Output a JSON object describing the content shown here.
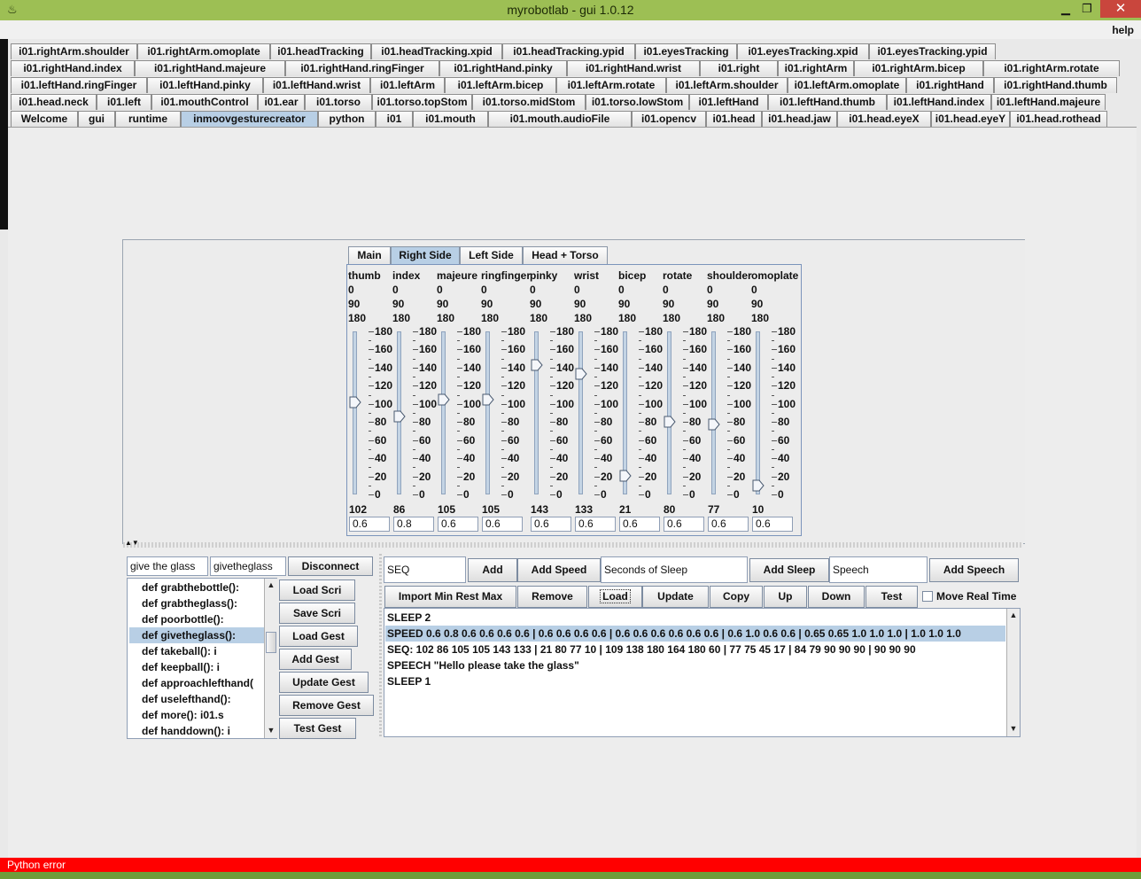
{
  "window": {
    "title": "myrobotlab - gui 1.0.12",
    "close_glyph": "✕",
    "min_glyph": "▁",
    "max_glyph": "❐"
  },
  "menu": {
    "help": "help"
  },
  "tabs": {
    "row1": [
      "i01.rightArm.shoulder",
      "i01.rightArm.omoplate",
      "i01.headTracking",
      "i01.headTracking.xpid",
      "i01.headTracking.ypid",
      "i01.eyesTracking",
      "i01.eyesTracking.xpid",
      "i01.eyesTracking.ypid"
    ],
    "row2": [
      "i01.rightHand.index",
      "i01.rightHand.majeure",
      "i01.rightHand.ringFinger",
      "i01.rightHand.pinky",
      "i01.rightHand.wrist",
      "i01.right",
      "i01.rightArm",
      "i01.rightArm.bicep",
      "i01.rightArm.rotate"
    ],
    "row3": [
      "i01.leftHand.ringFinger",
      "i01.leftHand.pinky",
      "i01.leftHand.wrist",
      "i01.leftArm",
      "i01.leftArm.bicep",
      "i01.leftArm.rotate",
      "i01.leftArm.shoulder",
      "i01.leftArm.omoplate",
      "i01.rightHand",
      "i01.rightHand.thumb"
    ],
    "row4": [
      "i01.head.neck",
      "i01.left",
      "i01.mouthControl",
      "i01.ear",
      "i01.torso",
      "i01.torso.topStom",
      "i01.torso.midStom",
      "i01.torso.lowStom",
      "i01.leftHand",
      "i01.leftHand.thumb",
      "i01.leftHand.index",
      "i01.leftHand.majeure"
    ],
    "row5": [
      "Welcome",
      "gui",
      "runtime",
      "inmoovgesturecreator",
      "python",
      "i01",
      "i01.mouth",
      "i01.mouth.audioFile",
      "i01.opencv",
      "i01.head",
      "i01.head.jaw",
      "i01.head.eyeX",
      "i01.head.eyeY",
      "i01.head.rothead"
    ],
    "selected_row5": "inmoovgesturecreator"
  },
  "inner_tabs": {
    "items": [
      "Main",
      "Right Side",
      "Left Side",
      "Head + Torso"
    ],
    "selected": "Right Side"
  },
  "sliders": {
    "min_label": "0",
    "mid_label": "90",
    "max_label": "180",
    "tick_labels": [
      "180",
      "160",
      "140",
      "120",
      "100",
      "80",
      "60",
      "40",
      "20",
      "0"
    ],
    "columns": [
      {
        "name": "thumb",
        "value": 102,
        "speed": "0.6"
      },
      {
        "name": "index",
        "value": 86,
        "speed": "0.8"
      },
      {
        "name": "majeure",
        "value": 105,
        "speed": "0.6"
      },
      {
        "name": "ringfinger",
        "value": 105,
        "speed": "0.6"
      },
      {
        "name": "pinky",
        "value": 143,
        "speed": "0.6"
      },
      {
        "name": "wrist",
        "value": 133,
        "speed": "0.6"
      },
      {
        "name": "bicep",
        "value": 21,
        "speed": "0.6"
      },
      {
        "name": "rotate",
        "value": 80,
        "speed": "0.6"
      },
      {
        "name": "shoulder",
        "value": 77,
        "speed": "0.6"
      },
      {
        "name": "omoplate",
        "value": 10,
        "speed": "0.6"
      }
    ]
  },
  "gesture": {
    "name_field": "give the glass",
    "func_field": "givetheglass",
    "disconnect": "Disconnect",
    "list": [
      "def grabthebottle():",
      "def grabtheglass():",
      "def poorbottle():",
      "def givetheglass():",
      "def takeball():   i",
      "def keepball():   i",
      "def approachlefthand(",
      "def uselefthand():",
      "def more():    i01.s",
      "def handdown():   i"
    ],
    "selected_index": 3,
    "buttons": [
      "Load Scri",
      "Save Scri",
      "Load Gest",
      "Add Gest",
      "Update Gest",
      "Remove Gest",
      "Test Gest"
    ]
  },
  "sequence": {
    "seq_field": "SEQ",
    "add": "Add",
    "add_speed": "Add Speed",
    "sleep_field": "Seconds of Sleep",
    "add_sleep": "Add Sleep",
    "speech_field": "Speech",
    "add_speech": "Add Speech",
    "row2_buttons": [
      "Import Min Rest Max",
      "Remove",
      "Load",
      "Update",
      "Copy",
      "Up",
      "Down",
      "Test"
    ],
    "move_real_time": "Move Real Time",
    "items": [
      "SLEEP   2",
      "SPEED   0.6 0.8 0.6 0.6 0.6 0.6 | 0.6 0.6 0.6 0.6 | 0.6 0.6 0.6 0.6 0.6 0.6 | 0.6 1.0 0.6 0.6 | 0.65 0.65 1.0 1.0 1.0 | 1.0 1.0 1.0",
      "SEQ: 102 86 105 105 143 133 | 21 80 77 10 | 109 138 180 164 180 60 | 77 75 45 17 | 84 79 90 90 90 | 90 90 90",
      "SPEECH   \"Hello please take the glass\"",
      "SLEEP   1"
    ],
    "selected_index": 1
  },
  "status": {
    "text": "Python error"
  }
}
